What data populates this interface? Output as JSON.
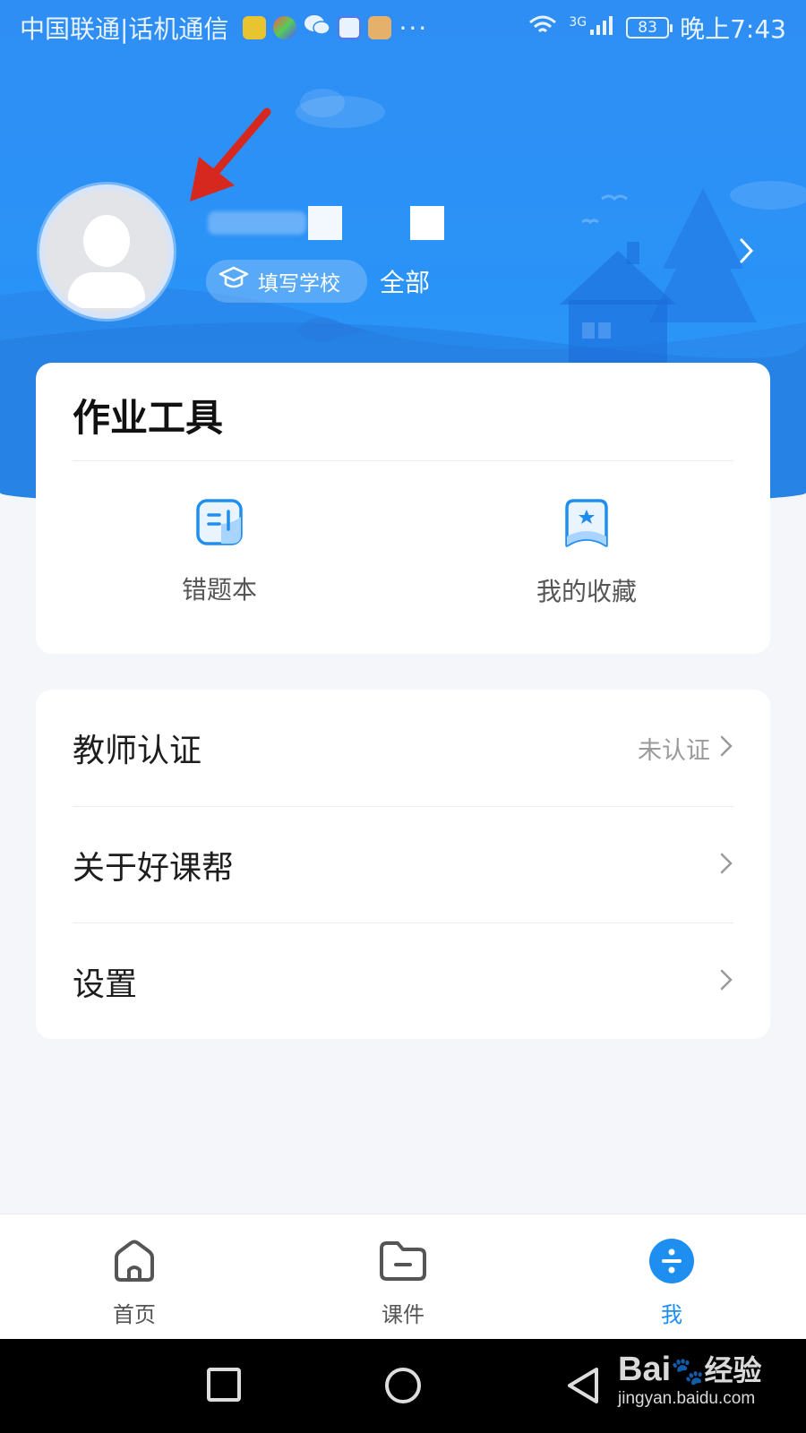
{
  "status_bar": {
    "carrier": "中国联通|话机通信",
    "network": "3G",
    "battery": "83",
    "time": "晚上7:43",
    "more": "···"
  },
  "profile": {
    "school_button": "填写学校",
    "grade": "全部"
  },
  "tools": {
    "title": "作业工具",
    "items": [
      {
        "label": "错题本",
        "icon": "notebook-icon"
      },
      {
        "label": "我的收藏",
        "icon": "bookmark-star-icon"
      }
    ]
  },
  "menu": {
    "items": [
      {
        "label": "教师认证",
        "status": "未认证"
      },
      {
        "label": "关于好课帮",
        "status": ""
      },
      {
        "label": "设置",
        "status": ""
      }
    ]
  },
  "tabs": [
    {
      "label": "首页",
      "icon": "home-icon",
      "active": false
    },
    {
      "label": "课件",
      "icon": "folder-icon",
      "active": false
    },
    {
      "label": "我",
      "icon": "me-divide-icon",
      "active": true
    }
  ],
  "watermark": {
    "logo": "Bai",
    "suffix": "经验",
    "url": "jingyan.baidu.com"
  },
  "colors": {
    "header_blue": "#2a93f7",
    "accent": "#1e8ef0",
    "annotation_arrow": "#d6281f"
  }
}
